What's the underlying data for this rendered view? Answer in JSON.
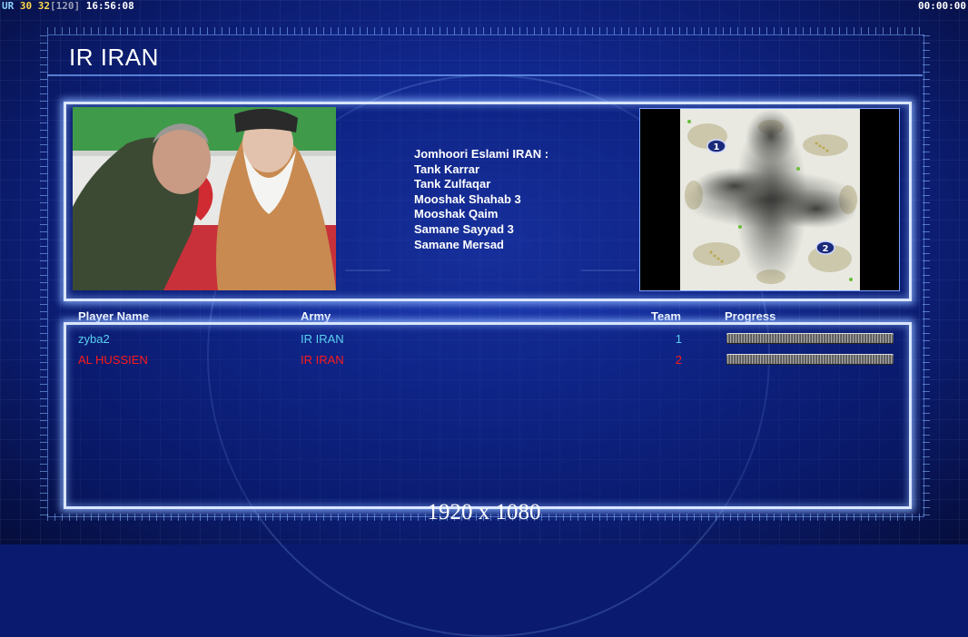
{
  "hud": {
    "ur": "UR",
    "fps_a": "30",
    "fps_b": "32",
    "fps_cap": "[120]",
    "clock": "16:56:08",
    "timer": "00:00:00"
  },
  "page_title": "IR IRAN",
  "faction": {
    "heading": "Jomhoori Eslami IRAN :",
    "units": [
      "Tank Karrar",
      "Tank Zulfaqar",
      "Mooshak Shahab 3",
      "Mooshak Qaim",
      "Samane Sayyad 3",
      "Samane Mersad"
    ]
  },
  "minimap": {
    "start_markers": [
      "1",
      "2"
    ]
  },
  "table": {
    "headers": {
      "player": "Player Name",
      "army": "Army",
      "team": "Team",
      "progress": "Progress"
    },
    "rows": [
      {
        "name": "zyba2",
        "army": "IR IRAN",
        "team": "1",
        "color": "#5ad0f0",
        "progress": 1.0
      },
      {
        "name": "AL HUSSIEN",
        "army": "IR IRAN",
        "team": "2",
        "color": "#ff1a1a",
        "progress": 1.0
      }
    ]
  },
  "resolution": "1920 x 1080",
  "colors": {
    "accent": "#d9e6ff",
    "background": "#122a94"
  }
}
